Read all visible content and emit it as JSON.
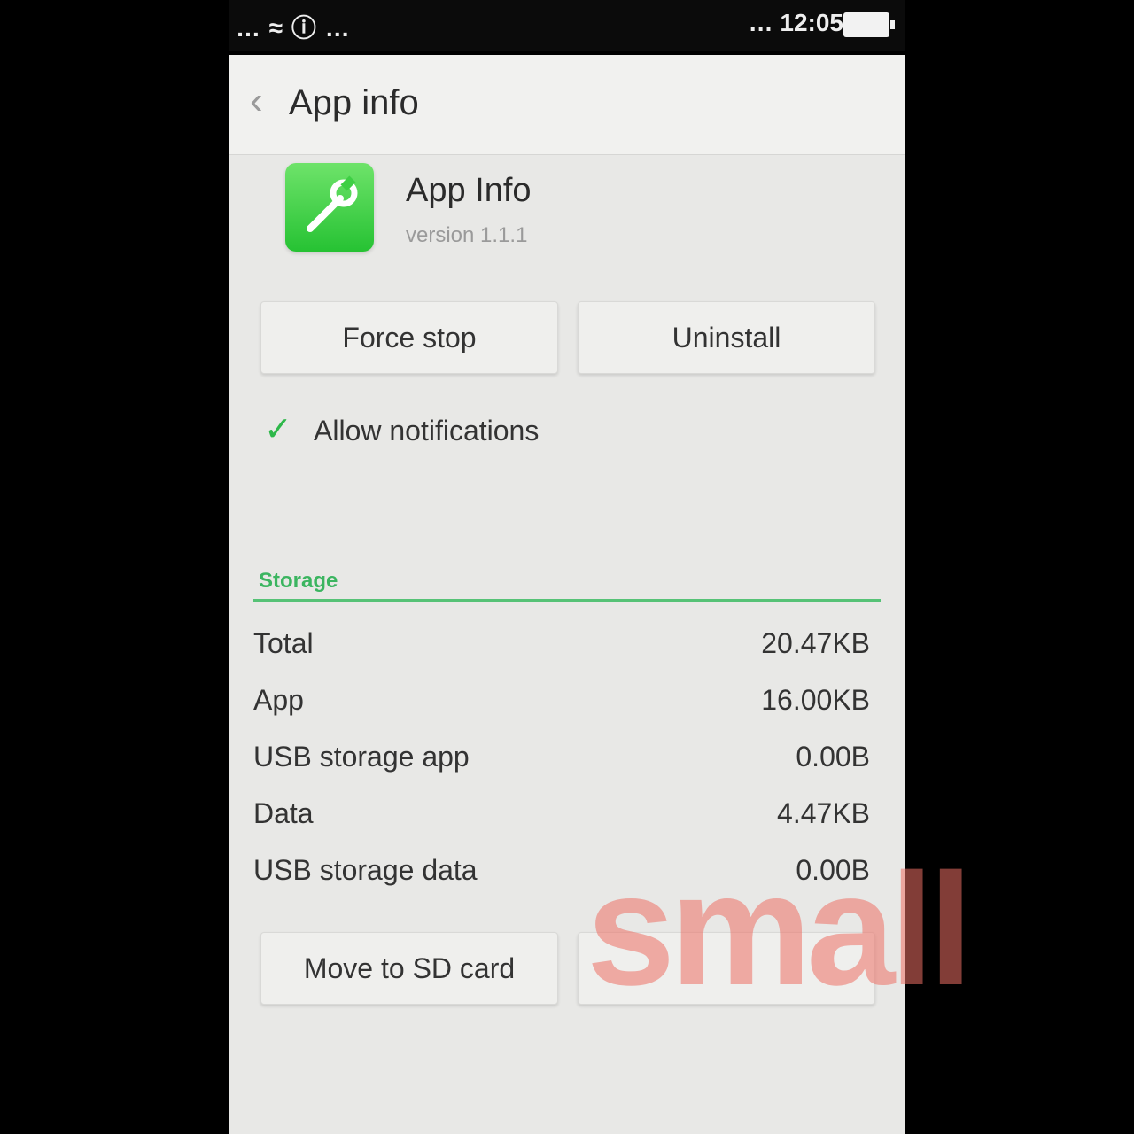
{
  "status_bar": {
    "left_text": "… ≈ ⓘ …",
    "right_text": "… 12:05"
  },
  "app_bar": {
    "title": "App info"
  },
  "app": {
    "name": "App Info",
    "version": "version 1.1.1"
  },
  "buttons": {
    "force_stop": "Force stop",
    "uninstall": "Uninstall"
  },
  "notifications": {
    "label": "Allow notifications",
    "checked": true
  },
  "storage": {
    "section_title": "Storage",
    "rows": [
      {
        "key": "Total",
        "value": "20.47KB"
      },
      {
        "key": "App",
        "value": "16.00KB"
      },
      {
        "key": "USB storage app",
        "value": "0.00B"
      },
      {
        "key": "Data",
        "value": "4.47KB"
      },
      {
        "key": "USB storage data",
        "value": "0.00B"
      }
    ],
    "move_button": "Move to SD card"
  },
  "watermark_text": "small",
  "colors": {
    "accent": "#3bb560",
    "app_icon": "#2fc63b",
    "watermark": "#ec7064"
  }
}
